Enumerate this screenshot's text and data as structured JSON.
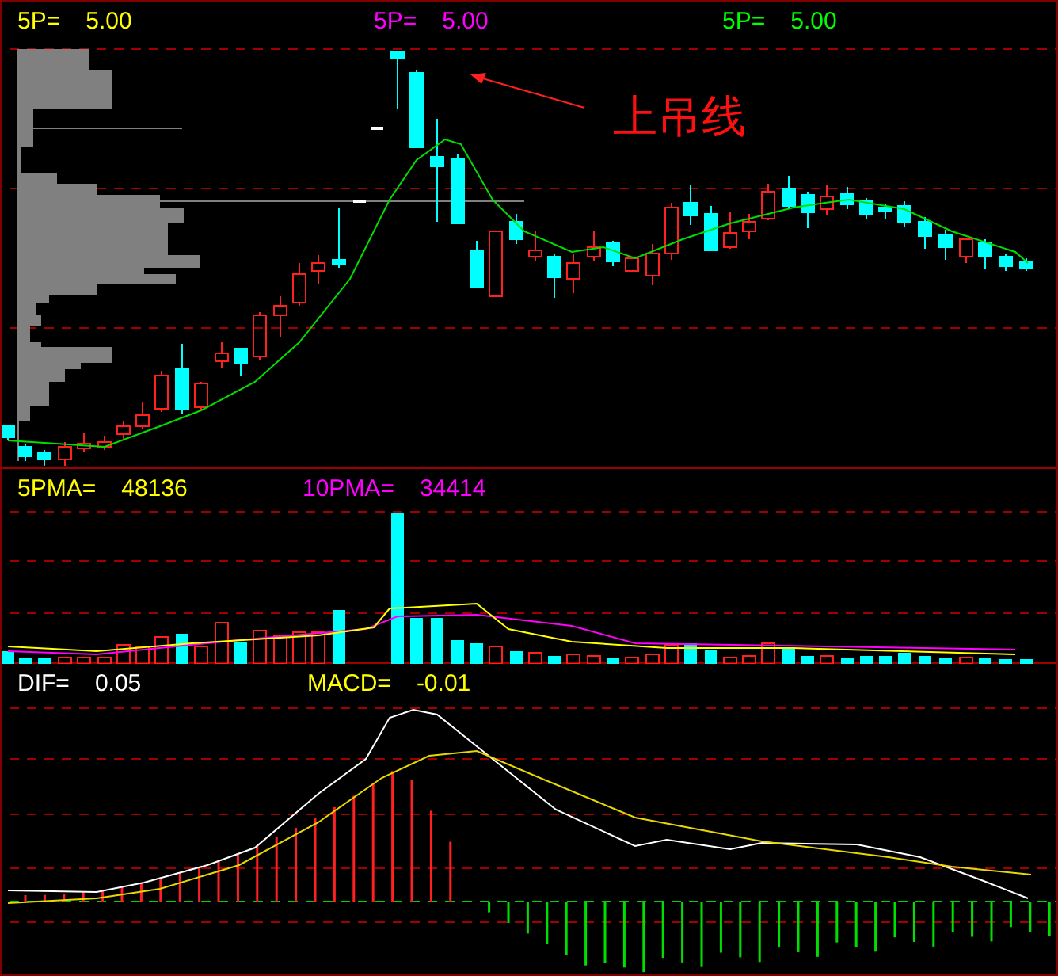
{
  "panels": [
    {
      "kind": "price",
      "legend": [
        {
          "label": "5P=",
          "value": "5.00",
          "color": "#ffff00"
        },
        {
          "label": "5P=",
          "value": "5.00",
          "color": "#ff00ff"
        },
        {
          "label": "5P=",
          "value": "5.00",
          "color": "#00ff00"
        }
      ],
      "annotation": "上吊线"
    },
    {
      "kind": "volume",
      "legend": [
        {
          "label": "5PMA=",
          "value": "48136",
          "color": "#ffff00"
        },
        {
          "label": "10PMA=",
          "value": "34414",
          "color": "#ff00ff"
        }
      ]
    },
    {
      "kind": "macd",
      "legend": [
        {
          "label": "DIF=",
          "value": "0.05",
          "color": "#ffffff"
        },
        {
          "label": "MACD=",
          "value": "-0.01",
          "color": "#ffff00"
        }
      ]
    }
  ]
}
